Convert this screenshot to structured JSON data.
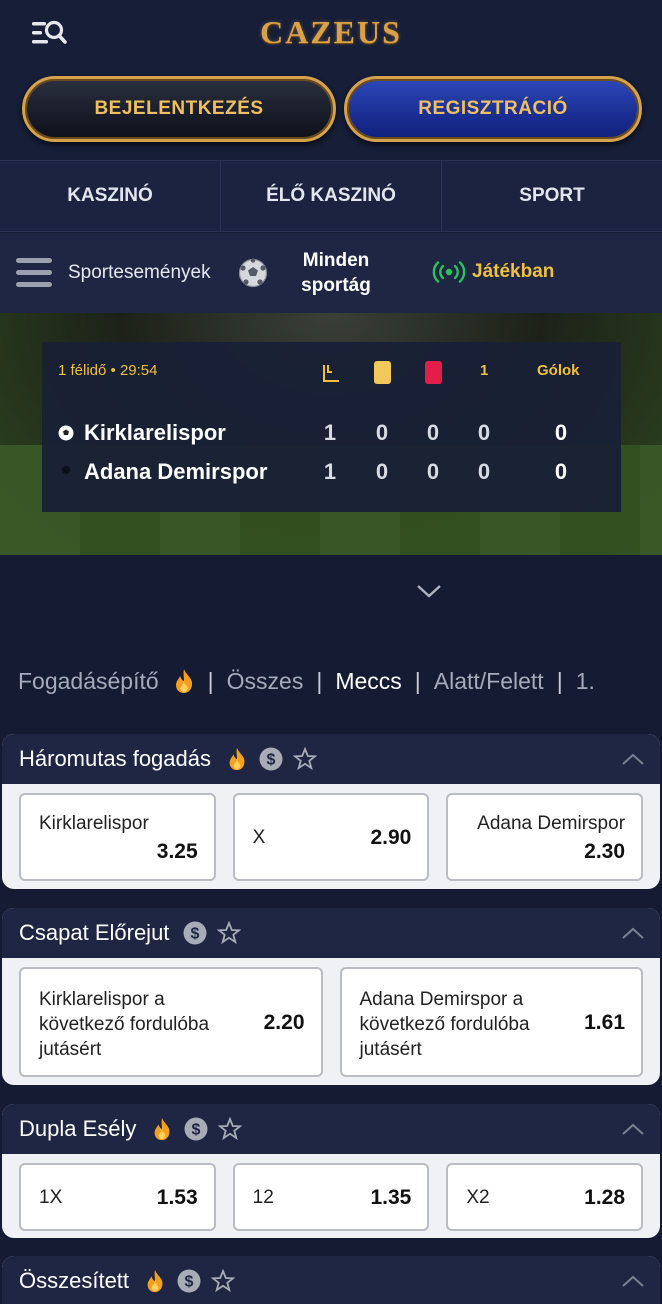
{
  "header": {
    "logo": "CAZEUS",
    "login_label": "BEJELENTKEZÉS",
    "register_label": "REGISZTRÁCIÓ"
  },
  "categories": [
    "KASZINÓ",
    "ÉLŐ KASZINÓ",
    "SPORT"
  ],
  "subnav": {
    "sport_events": "Sportesemények",
    "all_sports_1": "Minden",
    "all_sports_2": "sportág",
    "live": "Játékban"
  },
  "scoreboard": {
    "period": "1 félidő • 29:54",
    "col_period": "1",
    "col_goals": "Gólok",
    "teams": [
      {
        "name": "Kirklarelispor",
        "corners": "1",
        "yellow": "0",
        "red": "0",
        "first_half": "0",
        "goals": "0"
      },
      {
        "name": "Adana Demirspor",
        "corners": "1",
        "yellow": "0",
        "red": "0",
        "first_half": "0",
        "goals": "0"
      }
    ]
  },
  "market_tabs": {
    "builder": "Fogadásépítő",
    "all": "Összes",
    "match": "Meccs",
    "over_under": "Alatt/Felett",
    "first": "1."
  },
  "markets": {
    "three_way": {
      "title": "Háromutas fogadás",
      "options": [
        {
          "label": "Kirklarelispor",
          "odd": "3.25"
        },
        {
          "label": "X",
          "odd": "2.90"
        },
        {
          "label": "Adana Demirspor",
          "odd": "2.30"
        }
      ]
    },
    "advance": {
      "title": "Csapat Előrejut",
      "options": [
        {
          "line1": "Kirklarelispor a",
          "line2": "következő fordulóba",
          "line3": "jutásért",
          "odd": "2.20"
        },
        {
          "line1": "Adana Demirspor a",
          "line2": "következő fordulóba",
          "line3": "jutásért",
          "odd": "1.61"
        }
      ]
    },
    "double_chance": {
      "title": "Dupla Esély",
      "options": [
        {
          "label": "1X",
          "odd": "1.53"
        },
        {
          "label": "12",
          "odd": "1.35"
        },
        {
          "label": "X2",
          "odd": "1.28"
        }
      ]
    },
    "total": {
      "title": "Összesített"
    }
  },
  "colors": {
    "gold": "#f0c040",
    "navy": "#141b33",
    "live_green": "#2bc25a"
  }
}
